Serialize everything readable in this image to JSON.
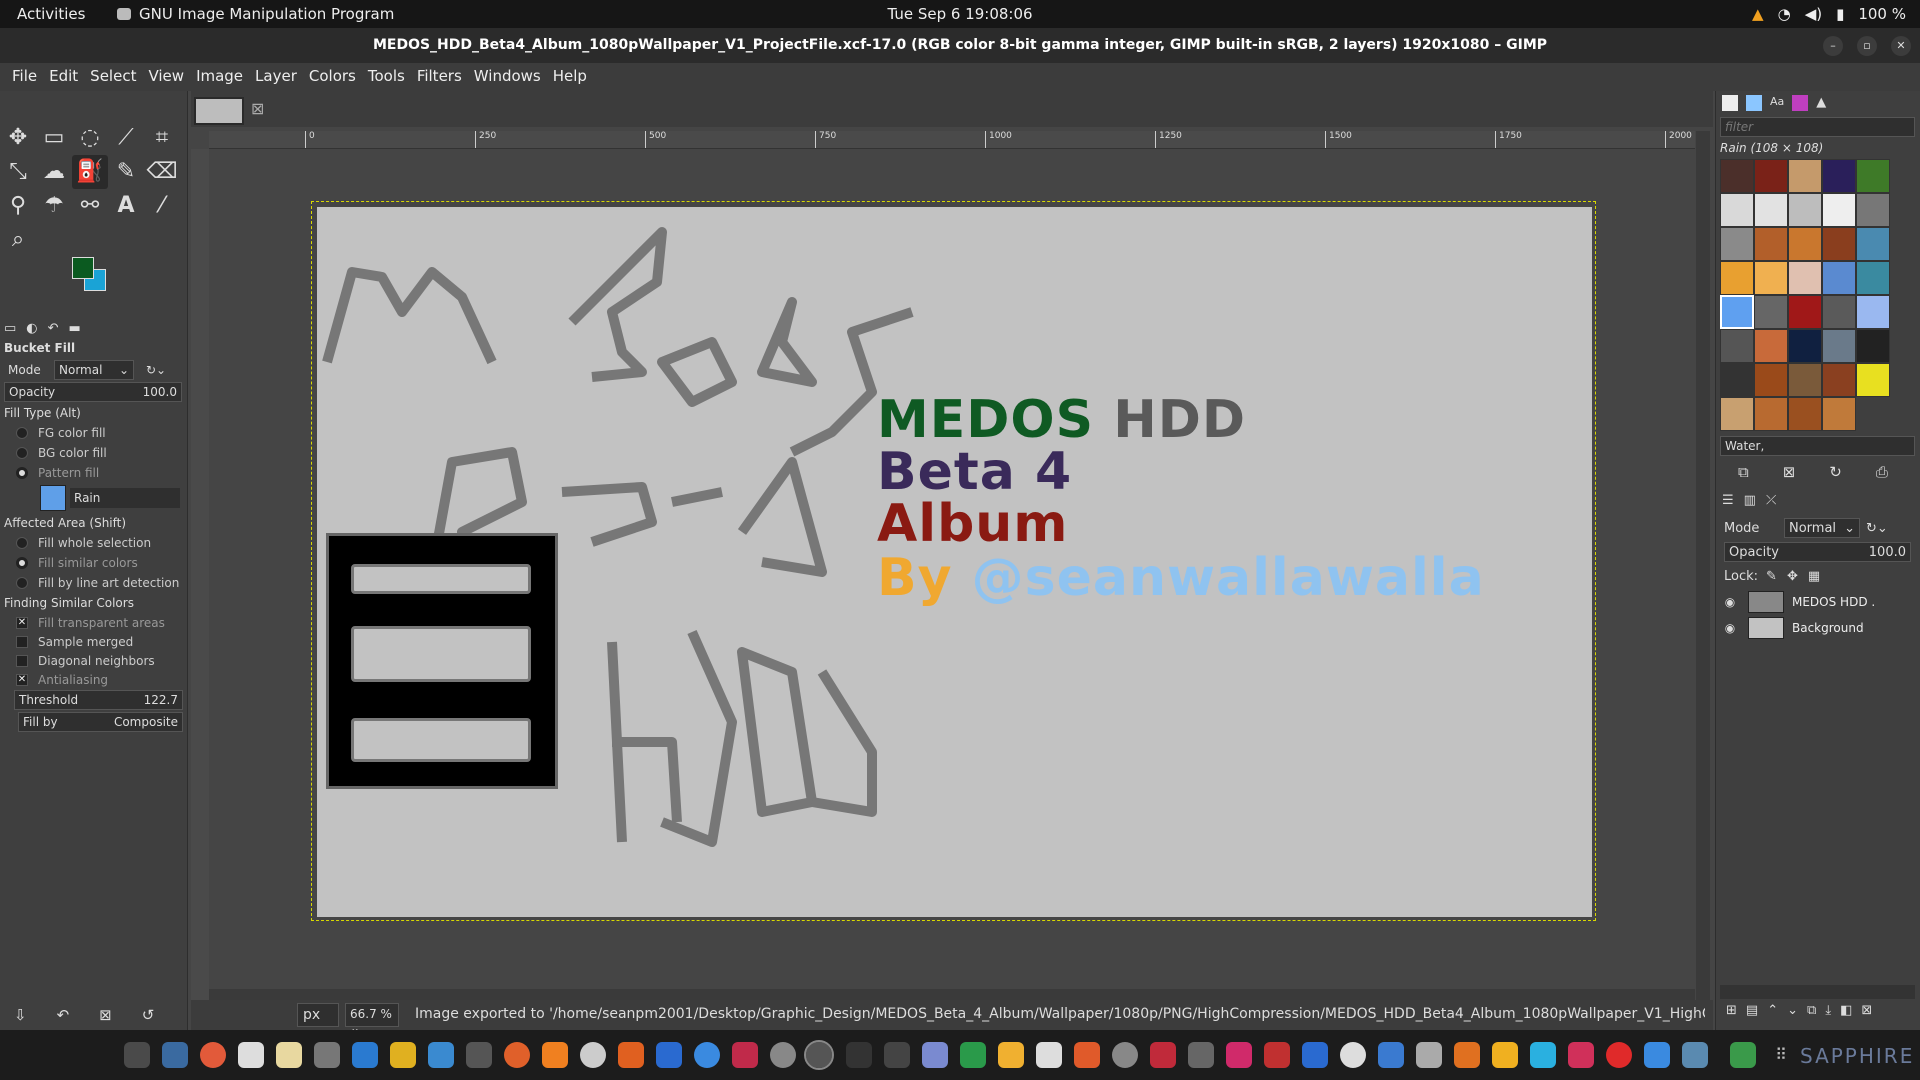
{
  "topbar": {
    "activities": "Activities",
    "app_name": "GNU Image Manipulation Program",
    "clock": "Tue Sep 6  19:08:06",
    "battery": "100 %"
  },
  "window": {
    "title": "MEDOS_HDD_Beta4_Album_1080pWallpaper_V1_ProjectFile.xcf-17.0 (RGB color 8-bit gamma integer, GIMP built-in sRGB, 2 layers) 1920x1080 – GIMP"
  },
  "menu": [
    "File",
    "Edit",
    "Select",
    "View",
    "Image",
    "Layer",
    "Colors",
    "Tools",
    "Filters",
    "Windows",
    "Help"
  ],
  "tool_options": {
    "title": "Bucket Fill",
    "mode_label": "Mode",
    "mode_value": "Normal",
    "opacity_label": "Opacity",
    "opacity_value": "100.0",
    "fill_type_label": "Fill Type  (Alt)",
    "fill_types": [
      "FG color fill",
      "BG color fill",
      "Pattern fill"
    ],
    "pattern_name": "Rain",
    "affected_label": "Affected Area  (Shift)",
    "affected": [
      "Fill whole selection",
      "Fill similar colors",
      "Fill by line art detection"
    ],
    "finding_label": "Finding Similar Colors",
    "finding": [
      "Fill transparent areas",
      "Sample merged",
      "Diagonal neighbors",
      "Antialiasing"
    ],
    "threshold_label": "Threshold",
    "threshold_value": "122.7",
    "fillby_label": "Fill by",
    "fillby_value": "Composite"
  },
  "ruler_ticks": [
    "0",
    "250",
    "500",
    "750",
    "1000",
    "1250",
    "1500",
    "1750",
    "2000"
  ],
  "canvas_text": {
    "line1a": "MEDOS",
    "line1b": "HDD",
    "line2": "Beta 4",
    "line3": "Album",
    "line4a": "By",
    "line4b": "@seanwallawalla",
    "colors": {
      "medos": "#0f5a23",
      "hdd": "#5a5a5a",
      "beta": "#3a2a5a",
      "album": "#8a1a12",
      "by": "#f0a830",
      "handle": "#8fc3f0"
    }
  },
  "patterns": {
    "filter_placeholder": "filter",
    "header": "Rain (108 × 108)",
    "selected_name": "Water,"
  },
  "layers": {
    "mode_label": "Mode",
    "mode_value": "Normal",
    "opacity_label": "Opacity",
    "opacity_value": "100.0",
    "lock_label": "Lock:",
    "items": [
      "MEDOS HDD .",
      "Background"
    ]
  },
  "statusbar": {
    "unit": "px",
    "zoom": "66.7 %",
    "message": "Image exported to '/home/seanpm2001/Desktop/Graphic_Design/MEDOS_Beta_4_Album/Wallpaper/1080p/PNG/HighCompression/MEDOS_HDD_Beta4_Album_1080pWallpaper_V1_HighC..."
  },
  "taskbar_label": "SAPPHIRE"
}
